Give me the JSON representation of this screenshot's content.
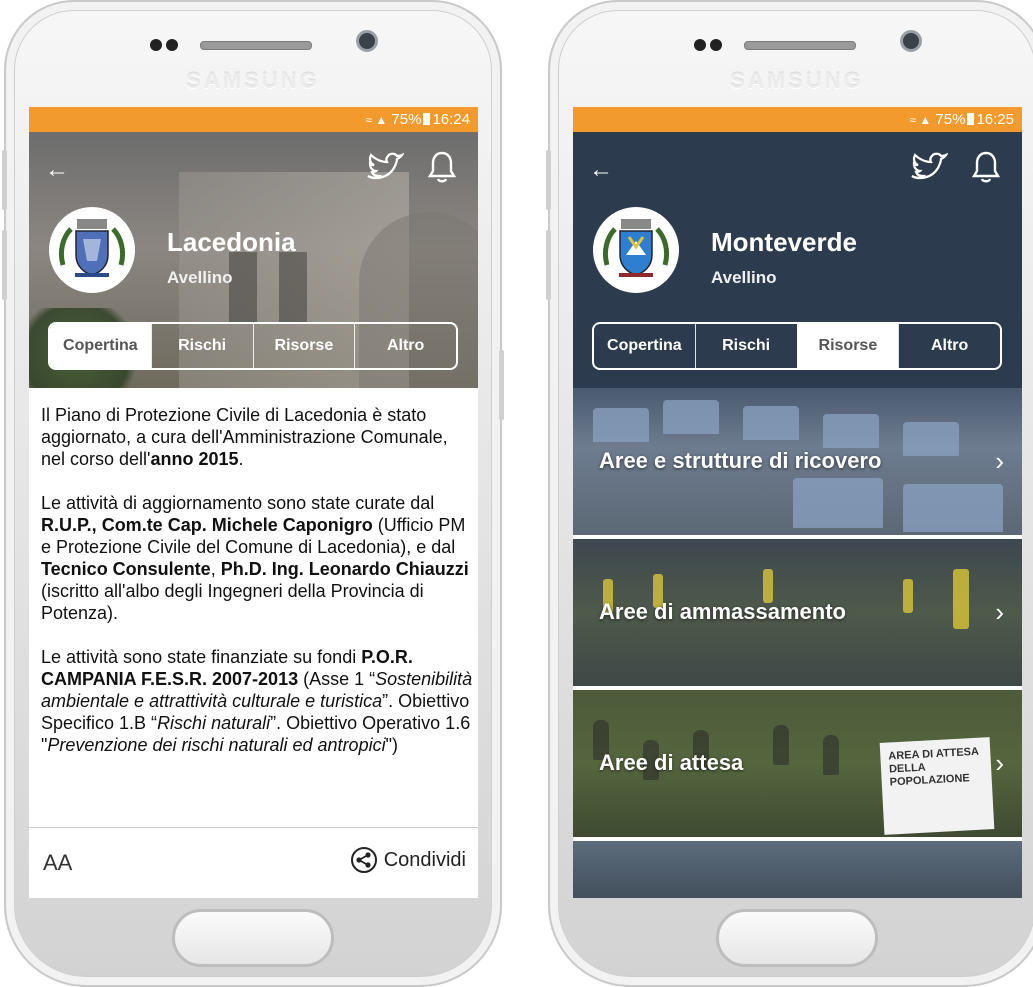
{
  "colors": {
    "status_bar": "#f29a2e",
    "navy_header": "#2c3c4e",
    "white": "#ffffff"
  },
  "left_phone": {
    "brand": "SAMSUNG",
    "status": {
      "signal": "…‷",
      "battery_pct": "75%",
      "time": "16:24"
    },
    "header": {
      "back_icon": "arrow-left-icon",
      "twitter_icon": "twitter-icon",
      "bell_icon": "bell-icon",
      "city": "Lacedonia",
      "province": "Avellino"
    },
    "tabs": [
      "Copertina",
      "Rischi",
      "Risorse",
      "Altro"
    ],
    "active_tab": "Copertina",
    "content": {
      "p1": {
        "t1": "Il Piano di Protezione Civile di Lacedonia è stato aggiornato, a cura dell'Amministrazione Comunale, nel corso dell'",
        "b1": "anno 2015",
        "t2": "."
      },
      "p2": {
        "t1": "Le attività di aggiornamento sono state curate dal ",
        "b1": "R.U.P., Com.te Cap. Michele Caponigro",
        "t2": " (Ufficio PM e Protezione Civile del Comune di Lacedonia), e dal ",
        "b2": "Tecnico Consulente",
        "t3": ", ",
        "b3": "Ph.D. Ing. Leonardo Chiauzzi",
        "t4": " (iscritto all'albo degli Ingegneri della Provincia di Potenza)."
      },
      "p3": {
        "t1": "Le attività sono state finanziate su fondi ",
        "b1": "P.O.R. CAMPANIA F.E.S.R. 2007-2013",
        "t2": " (Asse 1 “",
        "i1": "Sostenibilità ambientale e attrattività culturale e turistica",
        "t3": "”. Obiettivo Specifico 1.B “",
        "i2": "Rischi naturali",
        "t4": "”. Obiettivo Operativo 1.6 \"",
        "i3": "Prevenzione dei rischi naturali ed antropici",
        "t5": "\")"
      }
    },
    "bottom": {
      "font_size_label": "AA",
      "share_label": "Condividi",
      "share_icon": "share-icon"
    }
  },
  "right_phone": {
    "brand": "SAMSUNG",
    "status": {
      "battery_pct": "75%",
      "time": "16:25"
    },
    "header": {
      "back_icon": "arrow-left-icon",
      "twitter_icon": "twitter-icon",
      "bell_icon": "bell-icon",
      "city": "Monteverde",
      "province": "Avellino"
    },
    "tabs": [
      "Copertina",
      "Rischi",
      "Risorse",
      "Altro"
    ],
    "active_tab": "Risorse",
    "cards": [
      {
        "label": "Aree e strutture di ricovero"
      },
      {
        "label": "Aree di ammassamento"
      },
      {
        "label": "Aree di attesa",
        "sign_text": "AREA DI ATTESA DELLA POPOLAZIONE"
      },
      {
        "label": ""
      }
    ]
  }
}
